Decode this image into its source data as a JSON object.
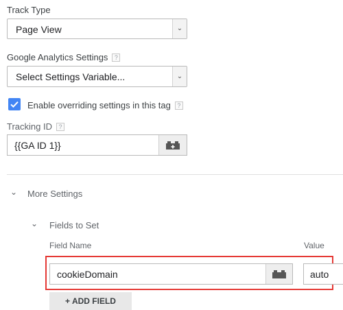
{
  "track_type": {
    "label": "Track Type",
    "value": "Page View"
  },
  "ga_settings": {
    "label": "Google Analytics Settings",
    "help": "?",
    "value": "Select Settings Variable..."
  },
  "override": {
    "label": "Enable overriding settings in this tag",
    "help": "?",
    "checked": true
  },
  "tracking_id": {
    "label": "Tracking ID",
    "help": "?",
    "value": "{{GA ID 1}}"
  },
  "more_settings": {
    "label": "More Settings"
  },
  "fields_to_set": {
    "label": "Fields to Set",
    "columns": {
      "field_name": "Field Name",
      "value": "Value"
    },
    "rows": [
      {
        "field_name": "cookieDomain",
        "value": "auto"
      }
    ],
    "add_button": "+ ADD FIELD"
  },
  "colors": {
    "accent": "#4285f4",
    "highlight": "#e53935"
  },
  "icons": {
    "dropdown": "chevron-down-icon",
    "variable": "variable-brick-icon",
    "check": "check-icon",
    "expand": "expand-chevron-icon"
  }
}
